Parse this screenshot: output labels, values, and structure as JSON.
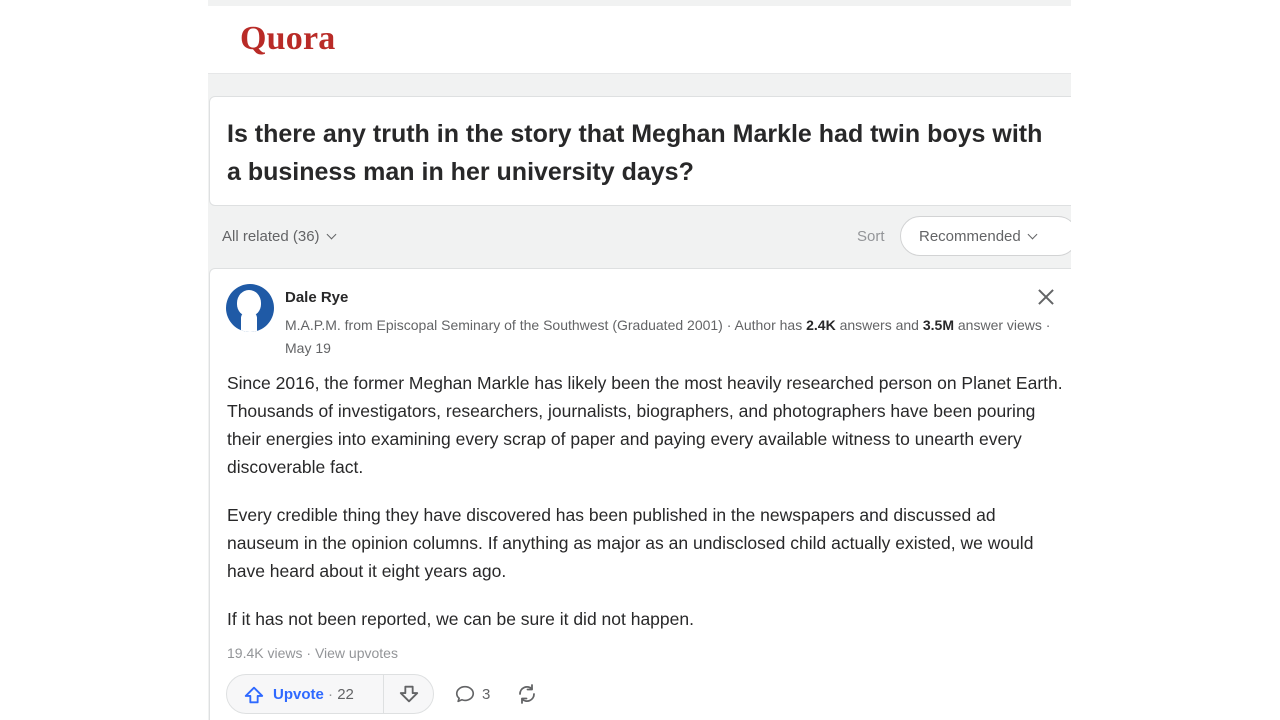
{
  "header": {
    "logo": "Quora"
  },
  "question": {
    "title": "Is there any truth in the story that Meghan Markle had twin boys with a business man in her university days?"
  },
  "filters": {
    "all_related": "All related (36)",
    "sort_label": "Sort",
    "sort_value": "Recommended"
  },
  "answer": {
    "author": "Dale Rye",
    "credential_prefix": "M.A.P.M. from Episcopal Seminary of the Southwest (Graduated 2001) · Author has ",
    "answers_count": "2.4K",
    "answers_suffix": " answers and ",
    "views_count": "3.5M",
    "views_suffix": " answer views · May 19",
    "paragraphs": [
      "Since 2016, the former Meghan Markle has likely been the most heavily researched person on Planet Earth. Thousands of investigators, researchers, journalists, biographers, and photographers have been pouring their energies into examining every scrap of paper and paying every available witness to unearth every discoverable fact.",
      "Every credible thing they have discovered has been published in the newspapers and discussed ad nauseum in the opinion columns. If anything as major as an undisclosed child actually existed, we would have heard about it eight years ago.",
      "If it has not been reported, we can be sure it did not happen."
    ],
    "views": "19.4K views",
    "stats_sep": " · ",
    "view_upvotes": "View upvotes",
    "upvote_label": "Upvote",
    "upvote_sep": " · ",
    "upvote_count": "22",
    "comment_count": "3"
  },
  "icons": {
    "close": "close-icon",
    "upvote": "upvote-arrow-icon",
    "downvote": "downvote-arrow-icon",
    "comment": "comment-bubble-icon",
    "share": "reshare-icon"
  },
  "colors": {
    "brand": "#b92b27",
    "upvote": "#2e69ff",
    "avatar": "#1f5aa6"
  }
}
